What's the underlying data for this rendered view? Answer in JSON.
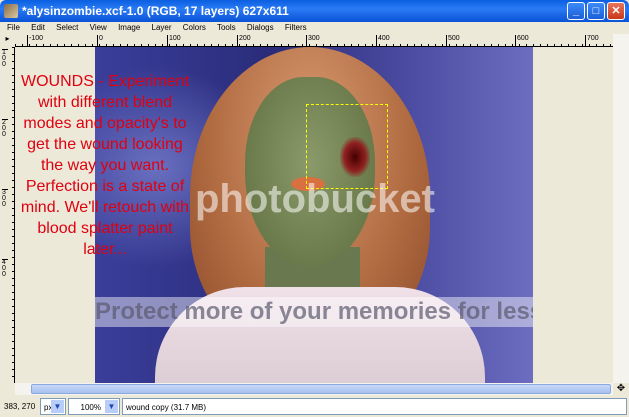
{
  "window": {
    "title": "*alysinzombie.xcf-1.0 (RGB, 17 layers) 627x611",
    "minimize": "_",
    "maximize": "□",
    "close": "✕"
  },
  "menu": [
    "File",
    "Edit",
    "Select",
    "View",
    "Image",
    "Layer",
    "Colors",
    "Tools",
    "Dialogs",
    "Filters"
  ],
  "hruler": [
    "-100",
    "0",
    "100",
    "200",
    "300",
    "400",
    "500",
    "600",
    "700"
  ],
  "vruler": [
    "100",
    "200",
    "300",
    "400"
  ],
  "canvas": {
    "note": "WOUNDS - Experiment with different blend modes and opacity's to get the wound looking the way you want. Perfection is a state of mind. We'll retouch with blood splatter paint later...",
    "watermark": "photobucket",
    "watermark_banner": "Protect more of your memories for less!"
  },
  "status": {
    "coords": "383, 270",
    "unit": "px",
    "zoom": "100%",
    "layer_info": "wound copy (31.7 MB)"
  }
}
